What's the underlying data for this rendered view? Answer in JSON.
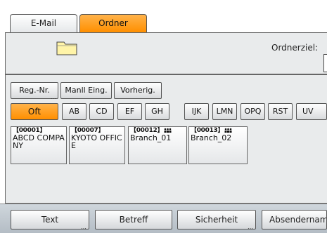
{
  "tabs": [
    {
      "label": "E-Mail",
      "active": false
    },
    {
      "label": "Ordner",
      "active": true
    }
  ],
  "destination": {
    "folder_icon": "folder-icon",
    "label": "Ordnerziel:",
    "value": ""
  },
  "search_buttons": {
    "reg_nr": "Reg.-Nr.",
    "manual": "Manll Eing.",
    "previous": "Vorherig."
  },
  "index_tabs": [
    "Oft",
    "AB",
    "CD",
    "EF",
    "GH",
    "IJK",
    "LMN",
    "OPQ",
    "RST",
    "UV"
  ],
  "selected_index": "Oft",
  "entries": [
    {
      "number": "【00001】",
      "name": "ABCD COMPANY",
      "group": false
    },
    {
      "number": "【00007】",
      "name": "KYOTO OFFICE",
      "group": false
    },
    {
      "number": "【00012】",
      "name": "Branch_01",
      "group": true
    },
    {
      "number": "【00013】",
      "name": "Branch_02",
      "group": true
    }
  ],
  "bottom_buttons": {
    "text": "Text",
    "subject": "Betreff",
    "security": "Sicherheit",
    "sender": "Absendername"
  },
  "colors": {
    "accent": "#ff9a00",
    "panel": "#e9ebec",
    "bottom_bar": "#bcc4cc"
  }
}
